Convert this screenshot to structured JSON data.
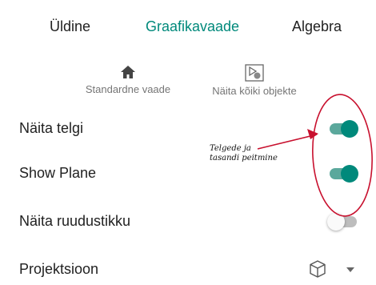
{
  "tabs": [
    {
      "label": "Üldine",
      "active": false
    },
    {
      "label": "Graafikavaade",
      "active": true
    },
    {
      "label": "Algebra",
      "active": false
    }
  ],
  "quick_actions": [
    {
      "label": "Standardne vaade",
      "icon": "home-icon"
    },
    {
      "label": "Näita kõiki objekte",
      "icon": "show-all-objects-icon"
    }
  ],
  "settings": [
    {
      "label": "Näita telgi",
      "toggle": "on"
    },
    {
      "label": "Show Plane",
      "toggle": "on"
    },
    {
      "label": "Näita ruudustikku",
      "toggle": "off"
    },
    {
      "label": "Projektsioon",
      "control": "projection-dropdown",
      "icon": "cube-icon"
    }
  ],
  "annotation": {
    "line1": "Telgede ja",
    "line2": "tasandi peitmine",
    "color": "#c8102e"
  },
  "colors": {
    "accent": "#00897b",
    "track_on": "#5ba89c",
    "text": "#212121",
    "muted": "#757575"
  }
}
